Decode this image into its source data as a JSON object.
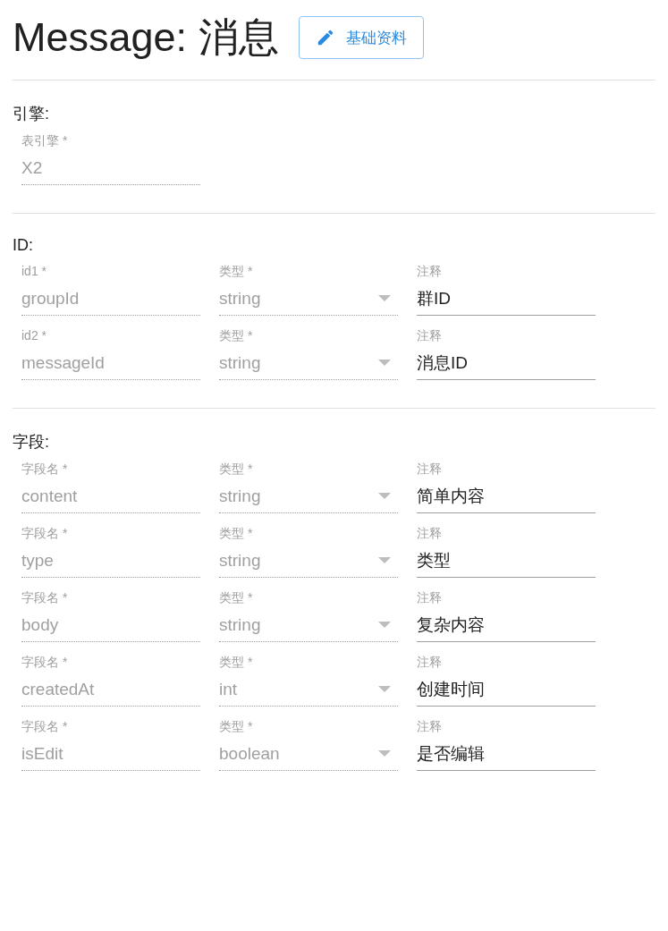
{
  "title": "Message: 消息",
  "edit_button": {
    "label": "基础资料"
  },
  "sections": [
    {
      "heading": "引擎:",
      "rows": [
        {
          "fields": [
            {
              "kind": "text",
              "label": "表引擎 *",
              "value": "X2",
              "disabled": true
            }
          ]
        }
      ]
    },
    {
      "heading": "ID:",
      "rows": [
        {
          "fields": [
            {
              "kind": "text",
              "label": "id1 *",
              "value": "groupId",
              "disabled": true
            },
            {
              "kind": "select",
              "label": "类型 *",
              "value": "string",
              "disabled": true
            },
            {
              "kind": "text",
              "label": "注释",
              "value": "群ID",
              "disabled": false
            }
          ]
        },
        {
          "fields": [
            {
              "kind": "text",
              "label": "id2 *",
              "value": "messageId",
              "disabled": true
            },
            {
              "kind": "select",
              "label": "类型 *",
              "value": "string",
              "disabled": true
            },
            {
              "kind": "text",
              "label": "注释",
              "value": "消息ID",
              "disabled": false
            }
          ]
        }
      ]
    },
    {
      "heading": "字段:",
      "rows": [
        {
          "fields": [
            {
              "kind": "text",
              "label": "字段名 *",
              "value": "content",
              "disabled": true
            },
            {
              "kind": "select",
              "label": "类型 *",
              "value": "string",
              "disabled": true
            },
            {
              "kind": "text",
              "label": "注释",
              "value": "简单内容",
              "disabled": false
            }
          ]
        },
        {
          "fields": [
            {
              "kind": "text",
              "label": "字段名 *",
              "value": "type",
              "disabled": true
            },
            {
              "kind": "select",
              "label": "类型 *",
              "value": "string",
              "disabled": true
            },
            {
              "kind": "text",
              "label": "注释",
              "value": "类型",
              "disabled": false
            }
          ]
        },
        {
          "fields": [
            {
              "kind": "text",
              "label": "字段名 *",
              "value": "body",
              "disabled": true
            },
            {
              "kind": "select",
              "label": "类型 *",
              "value": "string",
              "disabled": true
            },
            {
              "kind": "text",
              "label": "注释",
              "value": "复杂内容",
              "disabled": false
            }
          ]
        },
        {
          "fields": [
            {
              "kind": "text",
              "label": "字段名 *",
              "value": "createdAt",
              "disabled": true
            },
            {
              "kind": "select",
              "label": "类型 *",
              "value": "int",
              "disabled": true
            },
            {
              "kind": "text",
              "label": "注释",
              "value": "创建时间",
              "disabled": false
            }
          ]
        },
        {
          "fields": [
            {
              "kind": "text",
              "label": "字段名 *",
              "value": "isEdit",
              "disabled": true
            },
            {
              "kind": "select",
              "label": "类型 *",
              "value": "boolean",
              "disabled": true
            },
            {
              "kind": "text",
              "label": "注释",
              "value": "是否编辑",
              "disabled": false
            }
          ]
        }
      ]
    }
  ]
}
